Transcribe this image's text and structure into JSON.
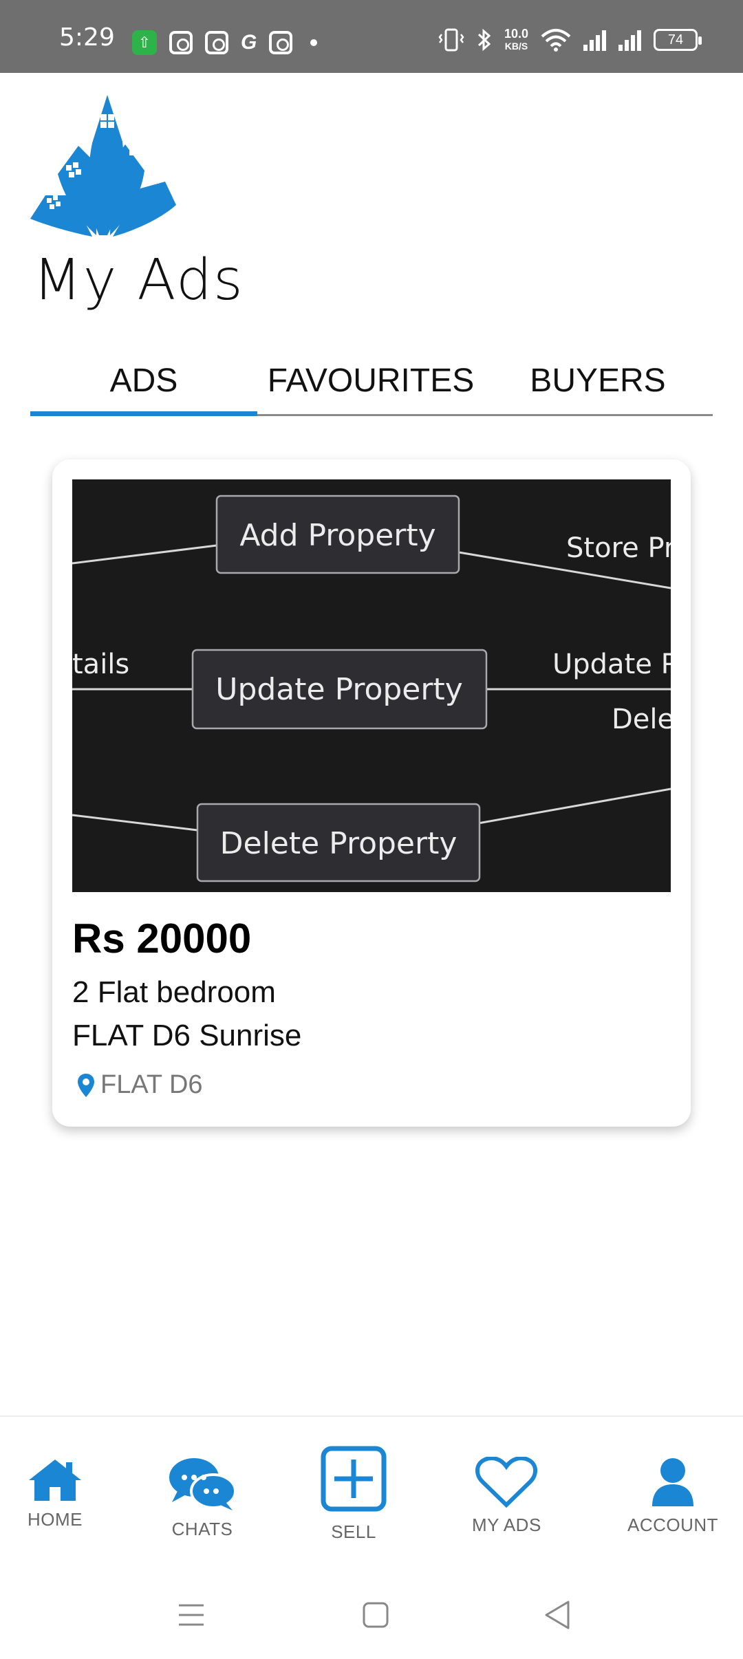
{
  "status_bar": {
    "time": "5:29",
    "speed_value": "10.0",
    "speed_unit": "KB/S",
    "battery": "74"
  },
  "header": {
    "title": "My Ads"
  },
  "tabs": [
    {
      "label": "ADS",
      "active": true
    },
    {
      "label": "FAVOURITES",
      "active": false
    },
    {
      "label": "BUYERS",
      "active": false
    }
  ],
  "ad_card": {
    "image_labels": {
      "node_add": "Add Property",
      "node_update": "Update Property",
      "node_delete": "Delete Property",
      "edge_left_middle": "tails",
      "edge_right_top": "Store Pr",
      "edge_right_middle": "Update P",
      "edge_right_lower": "Dele"
    },
    "price": "Rs 20000",
    "title": "2 Flat bedroom",
    "subtitle": "FLAT D6 Sunrise",
    "location": "FLAT D6"
  },
  "bottom_nav": [
    {
      "label": "HOME",
      "icon": "home-icon"
    },
    {
      "label": "CHATS",
      "icon": "chat-icon"
    },
    {
      "label": "SELL",
      "icon": "plus-square-icon"
    },
    {
      "label": "MY ADS",
      "icon": "heart-icon"
    },
    {
      "label": "ACCOUNT",
      "icon": "user-icon"
    }
  ],
  "colors": {
    "accent": "#1a86d4",
    "status_bar": "#6f6f6f",
    "diagram_bg": "#1b1a1b"
  }
}
